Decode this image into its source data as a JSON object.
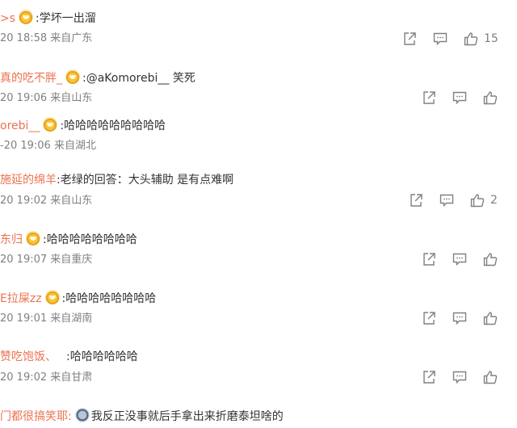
{
  "comments": [
    {
      "user": ">s",
      "text": ":学坏一出溜",
      "meta": "20 18:58 来自广东",
      "like_count": "15"
    },
    {
      "user": "真的吃不胖_",
      "text": ":@aKomorebi__ 笑死",
      "meta": "20 19:06 来自山东",
      "like_count": ""
    },
    {
      "user": "orebi__",
      "text": ":哈哈哈哈哈哈哈哈哈",
      "meta": "-20 19:06 来自湖北",
      "like_count": ""
    },
    {
      "user": "施延的绵羊",
      "text": ":老绿的回答：大头辅助 是有点难啊",
      "meta": "20 19:02 来自山东",
      "like_count": "2"
    },
    {
      "user": "东归",
      "text": ":哈哈哈哈哈哈哈哈",
      "meta": "20 19:07 来自重庆",
      "like_count": ""
    },
    {
      "user": "E拉屎zz",
      "text": ":哈哈哈哈哈哈哈哈",
      "meta": "20 19:01 来自湖南",
      "like_count": ""
    },
    {
      "user": "赞吃饱饭、",
      "text": ":哈哈哈哈哈哈",
      "meta": "20 19:02 来自甘肃",
      "like_count": ""
    },
    {
      "user": "门都很搞笑耶:",
      "text": "我反正没事就后手拿出来折磨泰坦啥的",
      "meta": "",
      "like_count": ""
    }
  ],
  "icons": {
    "share": "share-icon",
    "comment": "comment-icon",
    "like": "thumbs-up-icon"
  },
  "colors": {
    "username": "#eb7350",
    "text": "#333333",
    "meta": "#808080",
    "icon": "#808080"
  }
}
